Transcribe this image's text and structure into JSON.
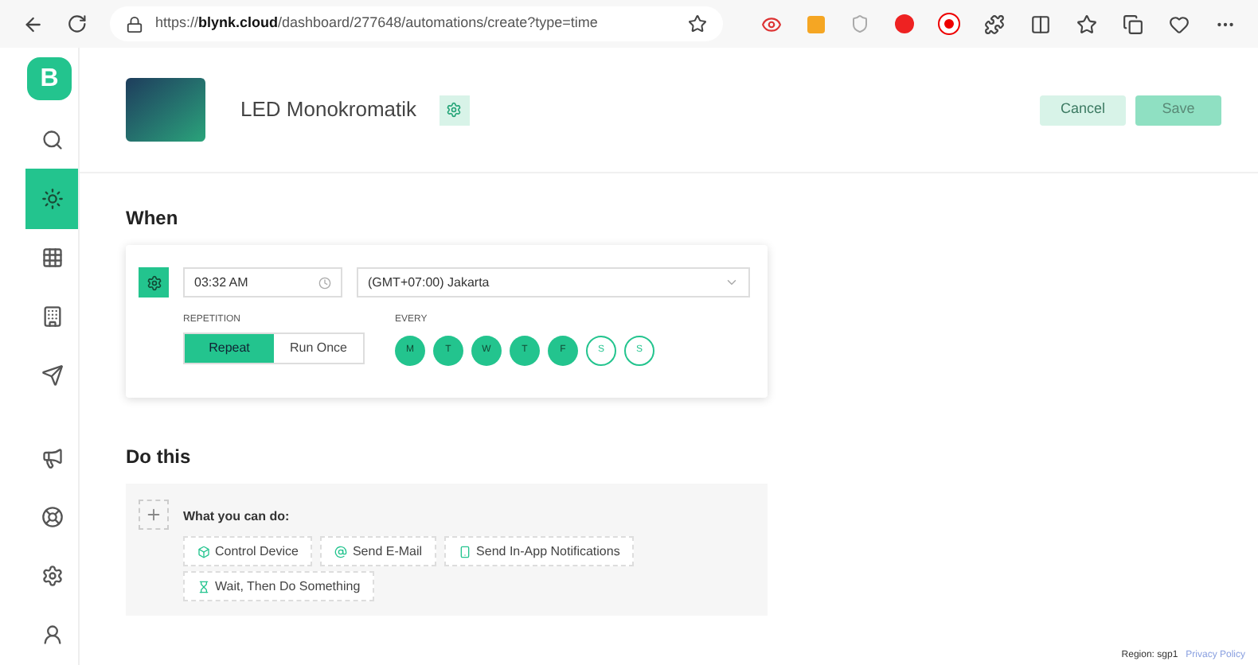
{
  "browser": {
    "url_prefix": "https://",
    "url_host": "blynk.cloud",
    "url_path": "/dashboard/277648/automations/create?type=time"
  },
  "sidebar": {
    "logo": "B",
    "items": [
      {
        "kind": "search",
        "selected": false
      },
      {
        "kind": "automation",
        "selected": true
      },
      {
        "kind": "grid",
        "selected": false
      },
      {
        "kind": "building",
        "selected": false
      },
      {
        "kind": "send",
        "selected": false
      },
      {
        "kind": "megaphone",
        "selected": false
      },
      {
        "kind": "lifebuoy",
        "selected": false
      },
      {
        "kind": "settings",
        "selected": false
      },
      {
        "kind": "user",
        "selected": false
      }
    ]
  },
  "header": {
    "title": "LED Monokromatik",
    "buttons": [
      {
        "label": "Cancel",
        "kind": "secondary"
      },
      {
        "label": "Save",
        "kind": "primary"
      }
    ]
  },
  "when": {
    "heading": "When",
    "time": "03:32 AM",
    "timezone": "(GMT+07:00) Jakarta",
    "repetition_label": "REPETITION",
    "repetition": [
      {
        "label": "Repeat",
        "selected": true
      },
      {
        "label": "Run Once",
        "selected": false
      }
    ],
    "every_label": "EVERY",
    "days": [
      {
        "label": "M",
        "selected": true
      },
      {
        "label": "T",
        "selected": true
      },
      {
        "label": "W",
        "selected": true
      },
      {
        "label": "T",
        "selected": true
      },
      {
        "label": "F",
        "selected": true
      },
      {
        "label": "S",
        "selected": false
      },
      {
        "label": "S",
        "selected": false
      }
    ]
  },
  "do_this": {
    "heading": "Do this",
    "prompt": "What you can do:",
    "actions": [
      {
        "label": "Control Device",
        "kind": "device"
      },
      {
        "label": "Send E-Mail",
        "kind": "email"
      },
      {
        "label": "Send In-App Notifications",
        "kind": "phone"
      },
      {
        "label": "Wait, Then Do Something",
        "kind": "wait"
      }
    ]
  },
  "footer": {
    "region": "Region: sgp1",
    "link": "Privacy Policy"
  }
}
